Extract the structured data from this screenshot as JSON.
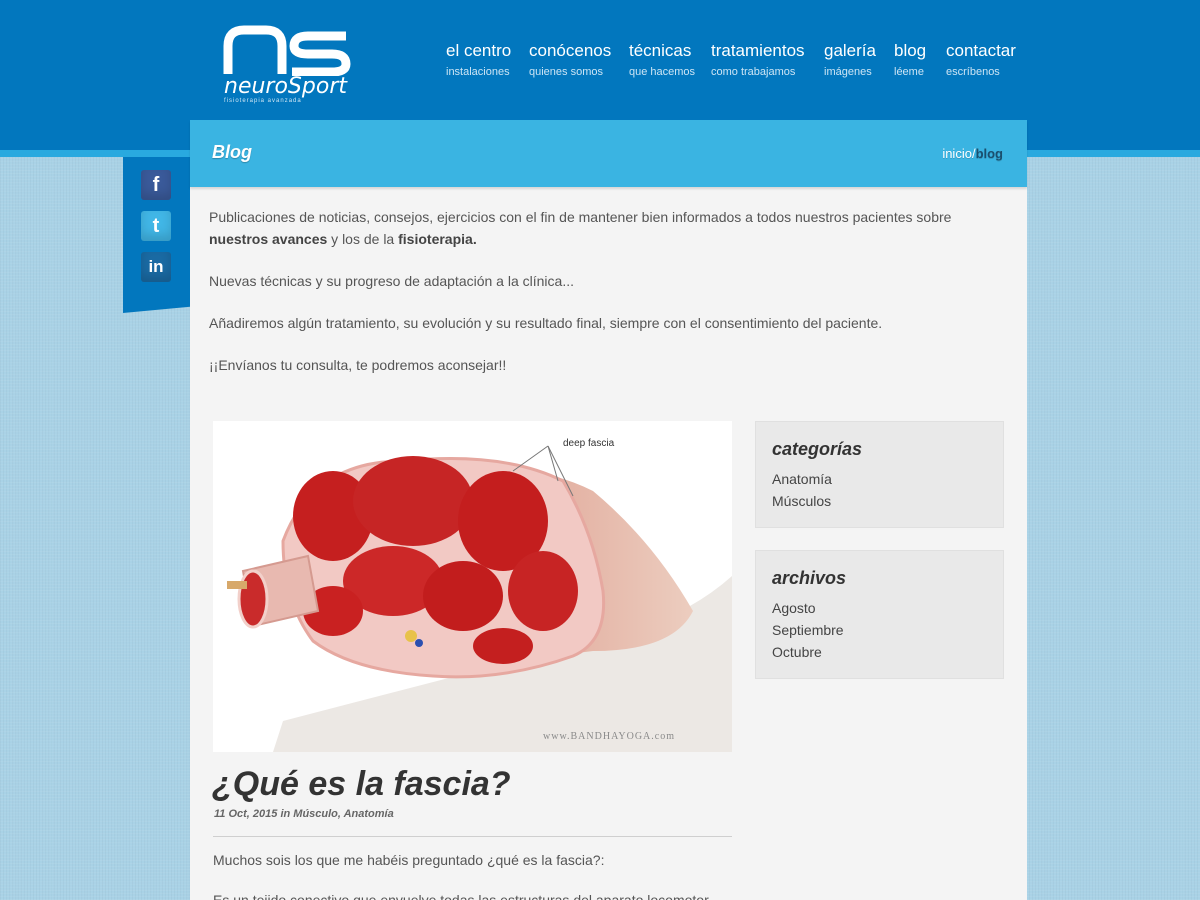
{
  "header": {
    "logo_word": "neuroSport",
    "logo_sub": "fisioterapia avanzada",
    "nav": [
      {
        "title": "el centro",
        "sub": "instalaciones"
      },
      {
        "title": "conócenos",
        "sub": "quienes somos"
      },
      {
        "title": "técnicas",
        "sub": "que hacemos"
      },
      {
        "title": "tratamientos",
        "sub": "como trabajamos"
      },
      {
        "title": "galería",
        "sub": "imágenes"
      },
      {
        "title": "blog",
        "sub": "léeme"
      },
      {
        "title": "contactar",
        "sub": "escríbenos"
      }
    ]
  },
  "social": {
    "facebook": "f",
    "twitter": "t",
    "linkedin": "in"
  },
  "banner": {
    "title": "Blog",
    "crumb_home": "inicio",
    "crumb_sep": "/",
    "crumb_current": "blog"
  },
  "intro": {
    "p1_a": "Publicaciones de noticias, consejos, ejercicios con el fin de mantener bien informados a todos nuestros pacientes sobre ",
    "p1_b": "nuestros avances",
    "p1_c": " y los de la ",
    "p1_d": "fisioterapia.",
    "p2": "Nuevas técnicas y su progreso de adaptación a la clínica...",
    "p3": "Añadiremos algún tratamiento, su evolución y su resultado final, siempre con el consentimiento del paciente.",
    "p4": "¡¡Envíanos tu consulta, te podremos aconsejar!!"
  },
  "post": {
    "image_label": "deep fascia",
    "image_watermark": "www.BANDHAYOGA.com",
    "title": "¿Qué es la fascia?",
    "meta": "11 Oct, 2015 in Músculo, Anatomía",
    "body_p1": "Muchos sois los que me habéis preguntado ¿qué es la fascia?:",
    "body_p2": "Es un tejido conectivo que envuelve todas las estructuras del aparato locomotor"
  },
  "sidebar": {
    "categories_title": "categorías",
    "categories": [
      "Anatomía",
      "Músculos"
    ],
    "archives_title": "archivos",
    "archives": [
      "Agosto",
      "Septiembre",
      "Octubre"
    ]
  },
  "colors": {
    "header_blue": "#0277be",
    "banner_blue": "#3ab4e2",
    "background": "#a9d2e6"
  }
}
